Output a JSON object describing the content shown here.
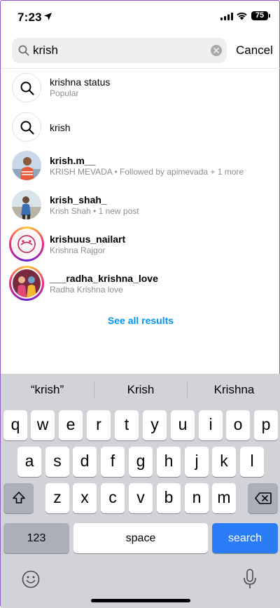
{
  "status_bar": {
    "time": "7:23",
    "battery": "75"
  },
  "search": {
    "value": "krish",
    "cancel_label": "Cancel"
  },
  "results": [
    {
      "type": "keyword",
      "title": "krishna  status",
      "subtitle": "Popular"
    },
    {
      "type": "keyword",
      "title": "krish",
      "subtitle": ""
    },
    {
      "type": "account",
      "title": "krish.m__",
      "subtitle": "KRISH MEVADA • Followed by apimevada + 1 more"
    },
    {
      "type": "account",
      "title": "krish_shah_",
      "subtitle": "Krish Shah • 1 new post"
    },
    {
      "type": "account",
      "title": "krishuus_nailart",
      "subtitle": "Krishna Rajgor"
    },
    {
      "type": "account",
      "title": "___radha_krishna_love",
      "subtitle": "Radha Krishna love"
    }
  ],
  "see_all_label": "See all results",
  "keyboard": {
    "suggestions": [
      "“krish”",
      "Krish",
      "Krishna"
    ],
    "row1": [
      "q",
      "w",
      "e",
      "r",
      "t",
      "y",
      "u",
      "i",
      "o",
      "p"
    ],
    "row2": [
      "a",
      "s",
      "d",
      "f",
      "g",
      "h",
      "j",
      "k",
      "l"
    ],
    "row3": [
      "z",
      "x",
      "c",
      "v",
      "b",
      "n",
      "m"
    ],
    "numbers_label": "123",
    "space_label": "space",
    "search_label": "search"
  },
  "colors": {
    "accent_blue": "#0095f6",
    "keyboard_blue": "#2a7cf6",
    "keyboard_bg": "#d1d3d9"
  }
}
